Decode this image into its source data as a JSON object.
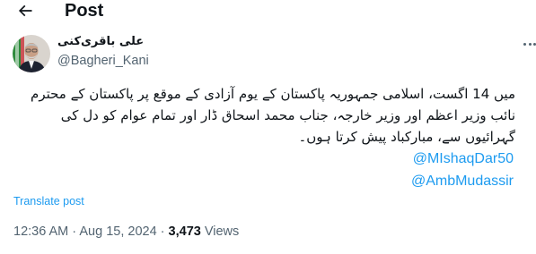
{
  "header": {
    "back_icon": "arrow-left-icon",
    "title": "Post"
  },
  "author": {
    "name": "علی باقری‌کنی",
    "handle": "@Bagheri_Kani",
    "avatar_icon": "profile-photo"
  },
  "more_icon": "more-horizontal-icon",
  "post": {
    "lines": [
      "میں 14 اگست، اسلامی جمہوریہ پاکستان کے یوم آزادی کے موقع پر پاکستان کے محترم",
      "نائب وزیر اعظم اور وزیر خارجہ، جناب محمد اسحاق ڈار اور تمام عوام کو دل کی",
      "گہرائیوں سے، مبارکباد پیش کرتا ہوں۔"
    ],
    "mentions": [
      "@MIshaqDar50",
      "@AmbMudassir"
    ],
    "translate_label": "Translate post"
  },
  "meta": {
    "time": "12:36 AM",
    "separator": " · ",
    "date": "Aug 15, 2024",
    "separator2": " · ",
    "views_count": "3,473",
    "views_label": " Views"
  },
  "colors": {
    "accent": "#1d9bf0",
    "secondary_text": "#536471",
    "primary_text": "#0f1419"
  }
}
